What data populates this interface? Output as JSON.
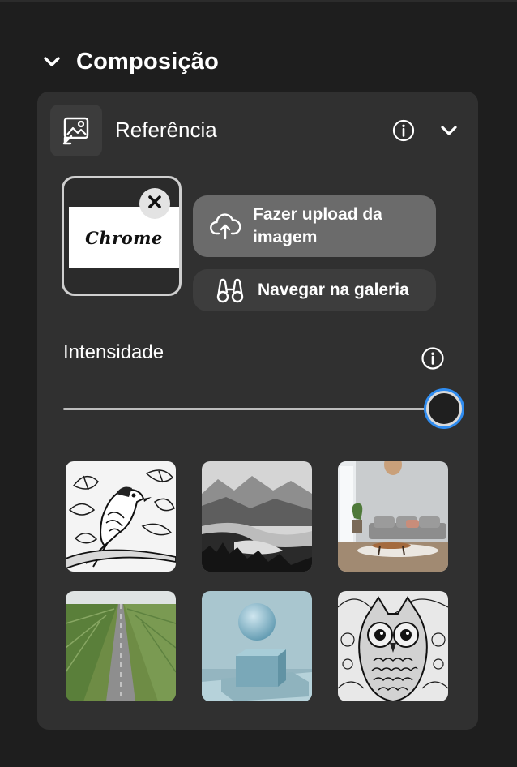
{
  "section": {
    "title": "Composição"
  },
  "reference": {
    "title": "Referência",
    "thumbnail_text": "Chrome",
    "upload_label": "Fazer upload da imagem",
    "gallery_label": "Navegar na galeria"
  },
  "intensity": {
    "label": "Intensidade",
    "value": 1.0
  },
  "presets": [
    {
      "name": "preset-bird-line-art"
    },
    {
      "name": "preset-misty-lake"
    },
    {
      "name": "preset-living-room"
    },
    {
      "name": "preset-road-fields"
    },
    {
      "name": "preset-sphere-cube"
    },
    {
      "name": "preset-owl-line-art"
    }
  ],
  "colors": {
    "background": "#1e1e1e",
    "panel": "#303030",
    "upload_button": "#6b6b6b",
    "gallery_button": "#3d3d3d",
    "slider_focus": "#2f8cf0"
  },
  "icons": {
    "section_toggle": "chevron-down-icon",
    "reference": "image-reference-icon",
    "info": "info-icon",
    "collapse": "chevron-down-icon",
    "remove": "close-icon",
    "upload": "cloud-upload-icon",
    "gallery": "binoculars-icon"
  }
}
